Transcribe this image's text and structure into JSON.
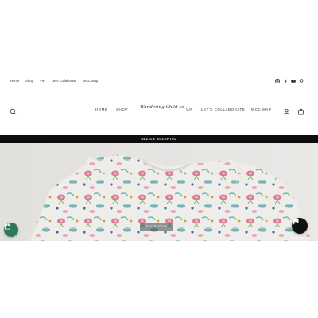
{
  "utility_bar": {
    "links": [
      "Home",
      "Shop",
      "VIP",
      "Let's Collaborate",
      "WCC Map"
    ],
    "social_icons": [
      "instagram-icon",
      "facebook-icon",
      "youtube-icon",
      "pinterest-icon"
    ]
  },
  "header": {
    "logo_text": "Wandering Child co",
    "nav_left": [
      "HOME",
      "SHOP"
    ],
    "nav_right": [
      "VIP",
      "LET'S COLLABORATE",
      "WCC MAP"
    ],
    "icons": [
      "search-icon",
      "account-icon",
      "cart-icon"
    ]
  },
  "announcement": {
    "text": "SEZZLE ACCEPTED"
  },
  "hero": {
    "button_label": "SHOP NOW",
    "image_subject": "floral teacup print baby dress"
  },
  "widgets": {
    "gift_icon": "gift-icon",
    "chat_icon": "chat-icon",
    "gift_color": "#2b7a5e",
    "chat_color": "#111111"
  },
  "colors": {
    "announcement_bg": "#0d0d0d",
    "text": "#333333"
  }
}
